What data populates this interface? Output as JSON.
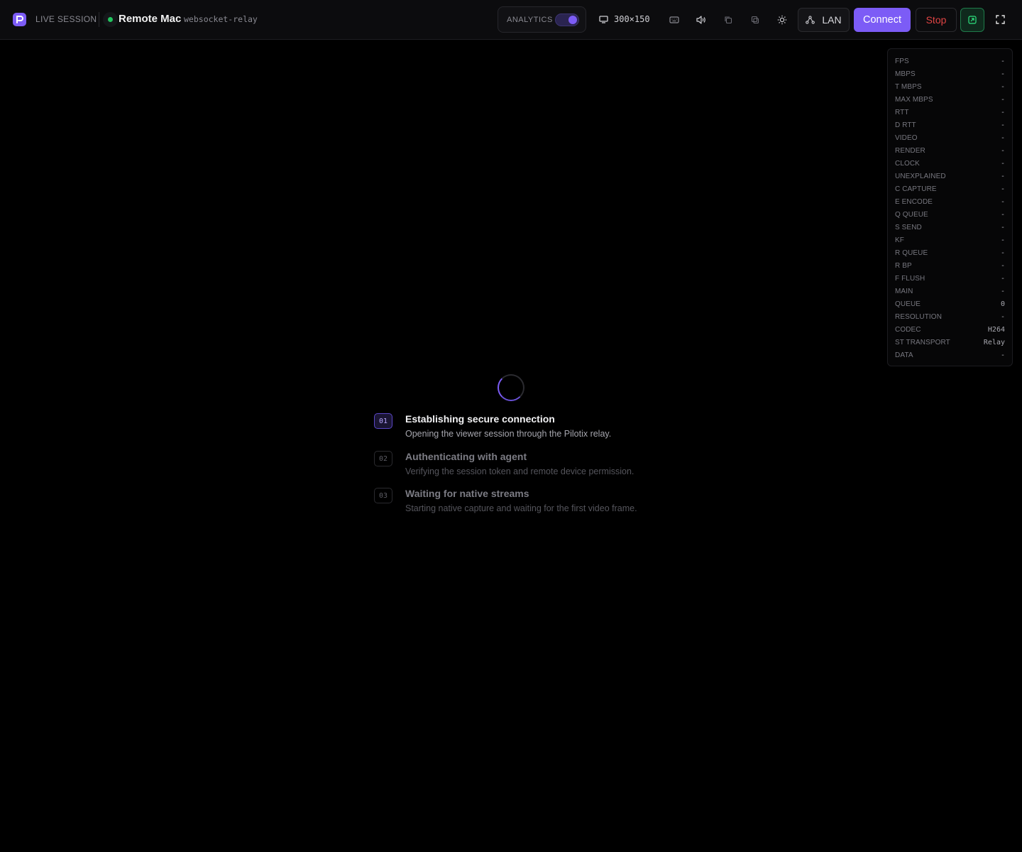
{
  "header": {
    "live_label": "LIVE SESSION",
    "device_name": "Remote Mac",
    "transport": "websocket-relay",
    "status": "online",
    "analytics_label": "ANALYTICS",
    "analytics_enabled": true,
    "resolution": "300×150",
    "lan_label": "LAN",
    "connect_label": "Connect",
    "stop_label": "Stop"
  },
  "icons": {
    "logo": "pilotix-logo-icon",
    "resolution": "monitor-icon",
    "keyboard": "keyboard-icon",
    "audio": "speaker-icon",
    "copy": "copy-icon",
    "paste": "paste-icon",
    "theme": "sun-icon",
    "lan": "network-icon",
    "pip": "picture-in-picture-icon",
    "fullscreen": "fullscreen-icon"
  },
  "colors": {
    "accent": "#7c5cf6",
    "online": "#22c55e",
    "stop": "#e04444",
    "pip": "#1f7a4a"
  },
  "stats": [
    {
      "key": "FPS",
      "value": "-"
    },
    {
      "key": "MBPS",
      "value": "-"
    },
    {
      "key": "T MBPS",
      "value": "-"
    },
    {
      "key": "MAX MBPS",
      "value": "-"
    },
    {
      "key": "RTT",
      "value": "-"
    },
    {
      "key": "D RTT",
      "value": "-"
    },
    {
      "key": "VIDEO",
      "value": "-"
    },
    {
      "key": "RENDER",
      "value": "-"
    },
    {
      "key": "CLOCK",
      "value": "-"
    },
    {
      "key": "UNEXPLAINED",
      "value": "-"
    },
    {
      "key": "C CAPTURE",
      "value": "-"
    },
    {
      "key": "E ENCODE",
      "value": "-"
    },
    {
      "key": "Q QUEUE",
      "value": "-"
    },
    {
      "key": "S SEND",
      "value": "-"
    },
    {
      "key": "KF",
      "value": "-"
    },
    {
      "key": "R QUEUE",
      "value": "-"
    },
    {
      "key": "R BP",
      "value": "-"
    },
    {
      "key": "F FLUSH",
      "value": "-"
    },
    {
      "key": "MAIN",
      "value": "-"
    },
    {
      "key": "QUEUE",
      "value": "0"
    },
    {
      "key": "RESOLUTION",
      "value": "-"
    },
    {
      "key": "CODEC",
      "value": "H264"
    },
    {
      "key": "ST TRANSPORT",
      "value": "Relay"
    },
    {
      "key": "DATA",
      "value": "-"
    }
  ],
  "steps": [
    {
      "num": "01",
      "title": "Establishing secure connection",
      "desc": "Opening the viewer session through the Pilotix relay.",
      "active": true
    },
    {
      "num": "02",
      "title": "Authenticating with agent",
      "desc": "Verifying the session token and remote device permission.",
      "active": false
    },
    {
      "num": "03",
      "title": "Waiting for native streams",
      "desc": "Starting native capture and waiting for the first video frame.",
      "active": false
    }
  ]
}
